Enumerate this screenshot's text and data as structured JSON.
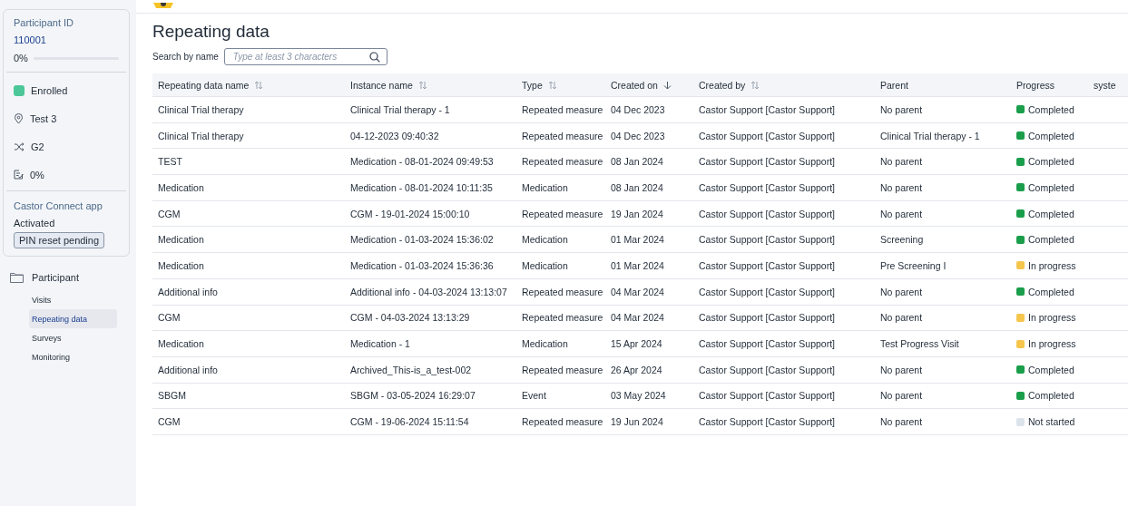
{
  "participant": {
    "id_label": "Participant ID",
    "id": "110001",
    "progress_text": "0%",
    "level": 0,
    "details": [
      {
        "kind": "status",
        "text": "Enrolled",
        "color": "#4cc79a"
      },
      {
        "kind": "site",
        "text": "Test 3"
      },
      {
        "kind": "group",
        "text": "G2"
      },
      {
        "kind": "completion",
        "text": "0%"
      }
    ],
    "app_label": "Castor Connect app",
    "app_status": "Activated",
    "pin_button": "PIN reset pending"
  },
  "nav": {
    "label": "Participant",
    "children": [
      {
        "label": "Visits",
        "selected": false
      },
      {
        "label": "Repeating data",
        "selected": true
      },
      {
        "label": "Surveys",
        "selected": false
      },
      {
        "label": "Monitoring",
        "selected": false
      }
    ]
  },
  "title": "Repeating data",
  "search": {
    "label": "Search by name",
    "placeholder": "Type at least 3 characters"
  },
  "table": {
    "columns": [
      {
        "label": "Repeating data name",
        "kind": "sortable"
      },
      {
        "label": "Instance name",
        "kind": "sortable"
      },
      {
        "label": "Type",
        "kind": "sortable"
      },
      {
        "label": "Created on",
        "kind": "sorted"
      },
      {
        "label": "Created by",
        "kind": "sortable"
      },
      {
        "label": "Parent",
        "kind": "plain"
      },
      {
        "label": "Progress",
        "kind": "plain"
      },
      {
        "label": "syste",
        "kind": "plain"
      }
    ],
    "rows": [
      {
        "cells": [
          "Clinical Trial therapy",
          "Clinical Trial therapy - 1",
          "Repeated measure",
          "04 Dec 2023",
          "Castor Support [Castor Support]",
          "No parent"
        ],
        "progress": "Completed",
        "color": "#1a9e4b"
      },
      {
        "cells": [
          "Clinical Trial therapy",
          "04-12-2023 09:40:32",
          "Repeated measure",
          "04 Dec 2023",
          "Castor Support [Castor Support]",
          "Clinical Trial therapy - 1"
        ],
        "progress": "Completed",
        "color": "#1a9e4b"
      },
      {
        "cells": [
          "TEST",
          "Medication - 08-01-2024 09:49:53",
          "Repeated measure",
          "08 Jan 2024",
          "Castor Support [Castor Support]",
          "No parent"
        ],
        "progress": "Completed",
        "color": "#1a9e4b"
      },
      {
        "cells": [
          "Medication",
          "Medication - 08-01-2024 10:11:35",
          "Medication",
          "08 Jan 2024",
          "Castor Support [Castor Support]",
          "No parent"
        ],
        "progress": "Completed",
        "color": "#1a9e4b"
      },
      {
        "cells": [
          "CGM",
          "CGM - 19-01-2024 15:00:10",
          "Repeated measure",
          "19 Jan 2024",
          "Castor Support [Castor Support]",
          "No parent"
        ],
        "progress": "Completed",
        "color": "#1a9e4b"
      },
      {
        "cells": [
          "Medication",
          "Medication - 01-03-2024 15:36:02",
          "Medication",
          "01 Mar 2024",
          "Castor Support [Castor Support]",
          "Screening"
        ],
        "progress": "Completed",
        "color": "#1a9e4b"
      },
      {
        "cells": [
          "Medication",
          "Medication - 01-03-2024 15:36:36",
          "Medication",
          "01 Mar 2024",
          "Castor Support [Castor Support]",
          "Pre Screening I"
        ],
        "progress": "In progress",
        "color": "#f5c54c"
      },
      {
        "cells": [
          "Additional info",
          "Additional info - 04-03-2024 13:13:07",
          "Repeated measure",
          "04 Mar 2024",
          "Castor Support [Castor Support]",
          "No parent"
        ],
        "progress": "Completed",
        "color": "#1a9e4b"
      },
      {
        "cells": [
          "CGM",
          "CGM - 04-03-2024 13:13:29",
          "Repeated measure",
          "04 Mar 2024",
          "Castor Support [Castor Support]",
          "No parent"
        ],
        "progress": "In progress",
        "color": "#f5c54c"
      },
      {
        "cells": [
          "Medication",
          "Medication - 1",
          "Medication",
          "15 Apr 2024",
          "Castor Support [Castor Support]",
          "Test Progress Visit"
        ],
        "progress": "In progress",
        "color": "#f5c54c"
      },
      {
        "cells": [
          "Additional info",
          "Archived_This-is_a_test-002",
          "Repeated measure",
          "26 Apr 2024",
          "Castor Support [Castor Support]",
          "No parent"
        ],
        "progress": "Completed",
        "color": "#1a9e4b"
      },
      {
        "cells": [
          "SBGM",
          "SBGM - 03-05-2024 16:29:07",
          "Event",
          "03 May 2024",
          "Castor Support [Castor Support]",
          "No parent"
        ],
        "progress": "Completed",
        "color": "#1a9e4b"
      },
      {
        "cells": [
          "CGM",
          "CGM - 19-06-2024 15:11:54",
          "Repeated measure",
          "19 Jun 2024",
          "Castor Support [Castor Support]",
          "No parent"
        ],
        "progress": "Not started",
        "color": "#dde3ea"
      }
    ]
  }
}
